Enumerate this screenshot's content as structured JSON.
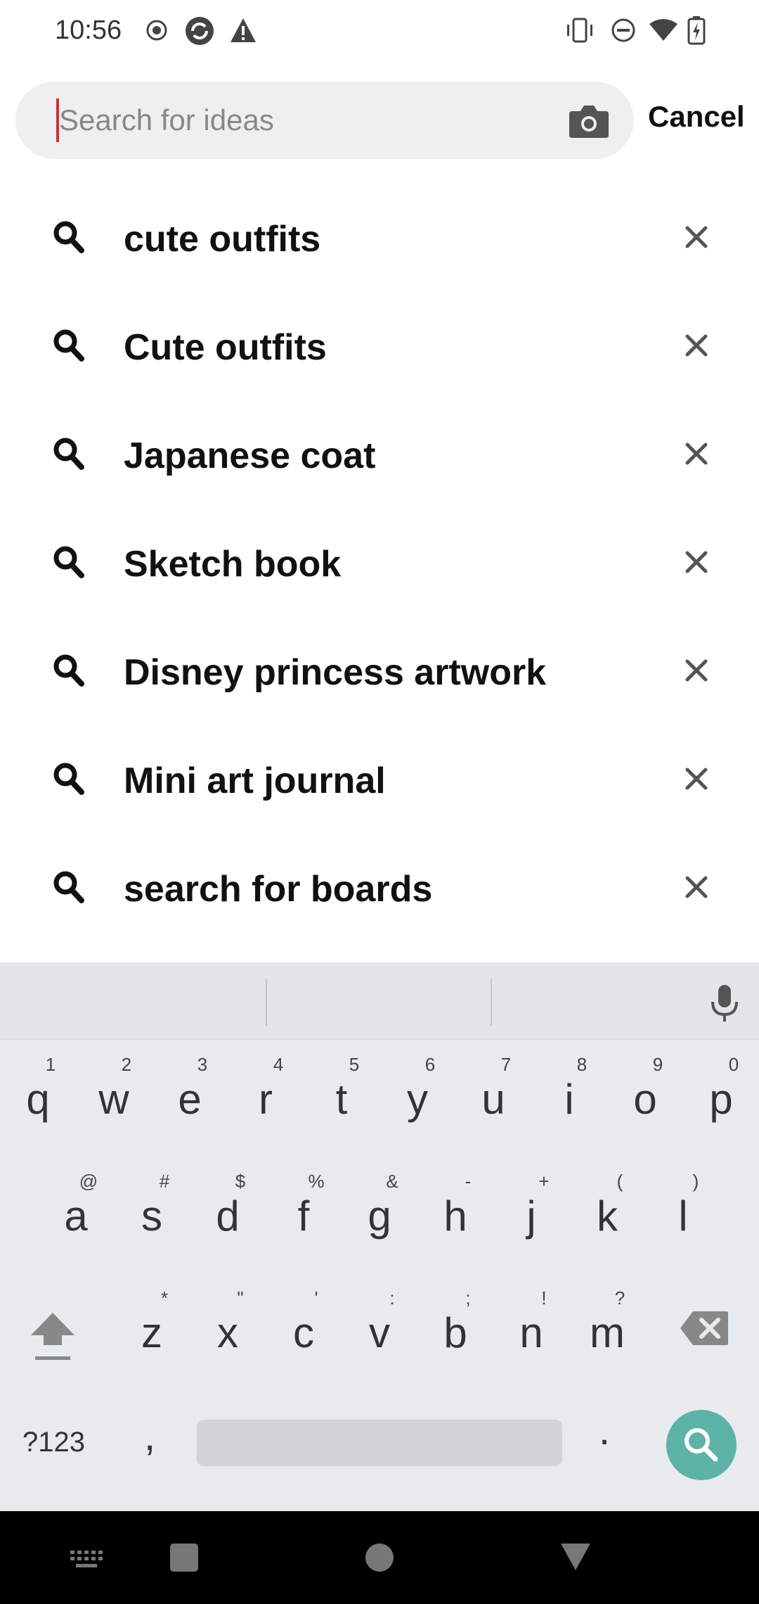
{
  "status_bar": {
    "time": "10:56",
    "left_icons": [
      "record-icon",
      "sync-icon",
      "warning-icon"
    ],
    "right_icons": [
      "vibrate-icon",
      "dnd-icon",
      "wifi-icon",
      "battery-charging-icon"
    ]
  },
  "search": {
    "placeholder": "Search for ideas",
    "value": "",
    "camera_icon": "camera-icon",
    "cancel_label": "Cancel"
  },
  "history": [
    {
      "label": "cute outfits"
    },
    {
      "label": "Cute outfits"
    },
    {
      "label": "Japanese coat"
    },
    {
      "label": "Sketch book"
    },
    {
      "label": "Disney princess artwork"
    },
    {
      "label": "Mini art journal"
    },
    {
      "label": "search for boards"
    }
  ],
  "keyboard": {
    "row1": [
      {
        "key": "q",
        "hint": "1"
      },
      {
        "key": "w",
        "hint": "2"
      },
      {
        "key": "e",
        "hint": "3"
      },
      {
        "key": "r",
        "hint": "4"
      },
      {
        "key": "t",
        "hint": "5"
      },
      {
        "key": "y",
        "hint": "6"
      },
      {
        "key": "u",
        "hint": "7"
      },
      {
        "key": "i",
        "hint": "8"
      },
      {
        "key": "o",
        "hint": "9"
      },
      {
        "key": "p",
        "hint": "0"
      }
    ],
    "row2": [
      {
        "key": "a",
        "hint": "@"
      },
      {
        "key": "s",
        "hint": "#"
      },
      {
        "key": "d",
        "hint": "$"
      },
      {
        "key": "f",
        "hint": "%"
      },
      {
        "key": "g",
        "hint": "&"
      },
      {
        "key": "h",
        "hint": "-"
      },
      {
        "key": "j",
        "hint": "+"
      },
      {
        "key": "k",
        "hint": "("
      },
      {
        "key": "l",
        "hint": ")"
      }
    ],
    "row3": [
      {
        "key": "z",
        "hint": "*"
      },
      {
        "key": "x",
        "hint": "\""
      },
      {
        "key": "c",
        "hint": "'"
      },
      {
        "key": "v",
        "hint": ":"
      },
      {
        "key": "b",
        "hint": ";"
      },
      {
        "key": "n",
        "hint": "!"
      },
      {
        "key": "m",
        "hint": "?"
      }
    ],
    "symbols_label": "?123",
    "comma": ",",
    "period": ".",
    "accent_color": "#5eb3a8"
  }
}
